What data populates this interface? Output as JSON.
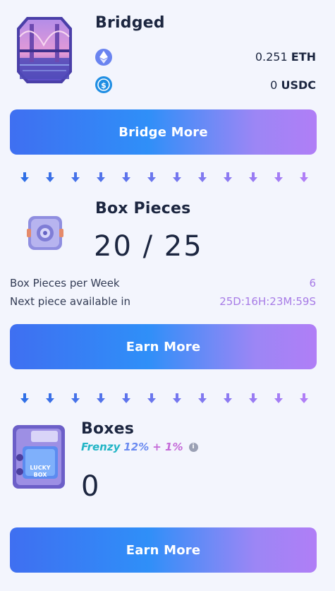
{
  "bridged": {
    "title": "Bridged",
    "eth_amount": "0.251",
    "eth_symbol": "ETH",
    "usdc_amount": "0",
    "usdc_symbol": "USDC",
    "button": "Bridge More"
  },
  "box_pieces": {
    "title": "Box Pieces",
    "count": "20 / 25",
    "per_week_label": "Box Pieces per Week",
    "per_week_value": "6",
    "next_label": "Next piece available in",
    "next_value": "25D:16H:23M:59S",
    "button": "Earn More"
  },
  "boxes": {
    "title": "Boxes",
    "frenzy_label": "Frenzy",
    "frenzy_pct": "12%",
    "bonus": "+ 1%",
    "count": "0",
    "box_badge": "LUCKY BOX",
    "button": "Earn More"
  },
  "colors": {
    "accent_start": "#3f6ff1",
    "accent_end": "#b07ef6",
    "value_purple": "#a77be6",
    "frenzy_teal": "#22b5c6",
    "bonus_pink": "#c46ad8"
  }
}
